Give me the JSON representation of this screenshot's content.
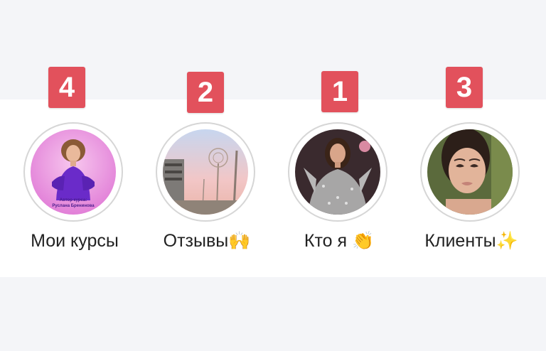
{
  "stories": [
    {
      "label": "Мои курсы",
      "badge": "4",
      "caption_line1": "Автор курса:",
      "caption_line2": "Руслана Бренинова",
      "icon": "avatar-courses-icon"
    },
    {
      "label": "Отзывы🙌",
      "badge": "2",
      "icon": "avatar-reviews-icon"
    },
    {
      "label": "Кто я 👏",
      "badge": "1",
      "icon": "avatar-about-icon"
    },
    {
      "label": "Клиенты✨",
      "badge": "3",
      "icon": "avatar-clients-icon"
    }
  ],
  "colors": {
    "badge": "#e2515c",
    "ring": "#d6d6d6",
    "background_band": "#f4f5f8",
    "text": "#222222"
  }
}
